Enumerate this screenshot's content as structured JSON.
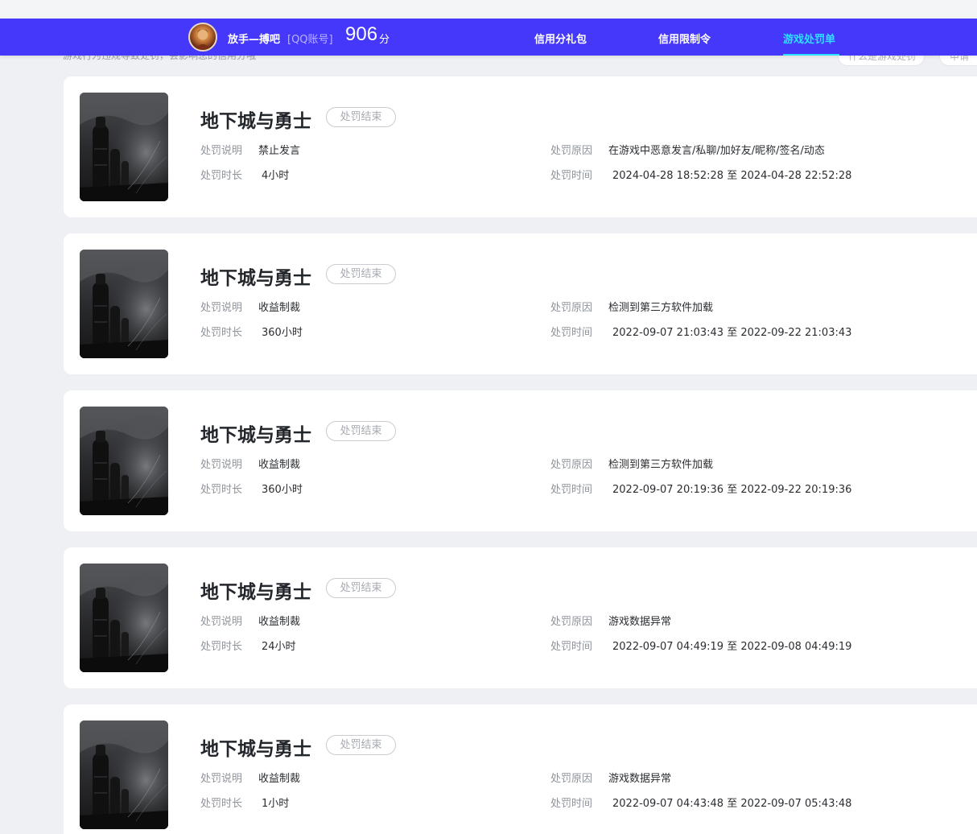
{
  "header": {
    "user_name": "放手—搏吧",
    "account_tag": "[QQ账号]",
    "score": "906",
    "score_unit": "分",
    "tabs": [
      {
        "label": "信用分礼包",
        "active": false
      },
      {
        "label": "信用限制令",
        "active": false
      },
      {
        "label": "游戏处罚单",
        "active": true
      }
    ],
    "colors": {
      "nav_bg": "#4538fb",
      "active_tab": "#2ce0ff"
    }
  },
  "subheader": {
    "note": "游戏行为违规导致处罚，会影响您的信用分哦",
    "buttons": [
      "什么是游戏处罚",
      "申请"
    ]
  },
  "labels": {
    "desc": "处罚说明",
    "duration": "处罚时长",
    "reason": "处罚原因",
    "time": "处罚时间",
    "time_sep": "至"
  },
  "records": [
    {
      "game": "地下城与勇士",
      "status": "处罚结束",
      "desc": "禁止发言",
      "duration": "4小时",
      "reason": "在游戏中恶意发言/私聊/加好友/昵称/签名/动态",
      "start": "2024-04-28 18:52:28",
      "end": "2024-04-28 22:52:28"
    },
    {
      "game": "地下城与勇士",
      "status": "处罚结束",
      "desc": "收益制裁",
      "duration": "360小时",
      "reason": "检测到第三方软件加载",
      "start": "2022-09-07 21:03:43",
      "end": "2022-09-22 21:03:43"
    },
    {
      "game": "地下城与勇士",
      "status": "处罚结束",
      "desc": "收益制裁",
      "duration": "360小时",
      "reason": "检测到第三方软件加载",
      "start": "2022-09-07 20:19:36",
      "end": "2022-09-22 20:19:36"
    },
    {
      "game": "地下城与勇士",
      "status": "处罚结束",
      "desc": "收益制裁",
      "duration": "24小时",
      "reason": "游戏数据异常",
      "start": "2022-09-07 04:49:19",
      "end": "2022-09-08 04:49:19"
    },
    {
      "game": "地下城与勇士",
      "status": "处罚结束",
      "desc": "收益制裁",
      "duration": "1小时",
      "reason": "游戏数据异常",
      "start": "2022-09-07 04:43:48",
      "end": "2022-09-07 05:43:48"
    }
  ]
}
